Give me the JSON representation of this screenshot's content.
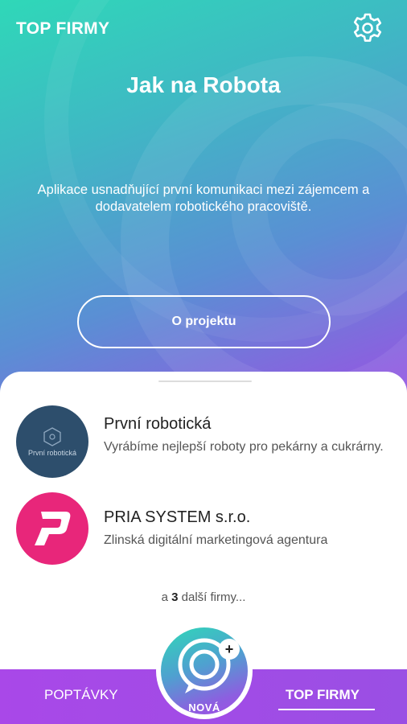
{
  "header": {
    "brand": "TOP FIRMY",
    "settings_icon": "gear-icon"
  },
  "hero": {
    "title": "Jak na Robota",
    "subtitle": "Aplikace usnadňující první komunikaci mezi zájemcem a dodavatelem robotického pracoviště.",
    "project_button": "O projektu"
  },
  "companies": [
    {
      "name": "První robotická",
      "description": "Vyrábíme nejlepší roboty pro pekárny a cukrárny.",
      "logo_text": "První robotická"
    },
    {
      "name": "PRIA SYSTEM s.r.o.",
      "description": "Zlinská digitální marketingová agentura"
    }
  ],
  "more": {
    "prefix": "a",
    "count": "3",
    "suffix": "další firmy..."
  },
  "bottom_nav": {
    "left_tab": "POPTÁVKY",
    "right_tab": "TOP FIRMY",
    "fab_label": "NOVÁ",
    "fab_plus": "+"
  },
  "colors": {
    "gradient_start": "#2fd8b8",
    "gradient_end": "#9b55e4",
    "nav_bar": "#a948e8",
    "pria_logo": "#e8267a",
    "robotic_logo": "#2d4e6c"
  }
}
